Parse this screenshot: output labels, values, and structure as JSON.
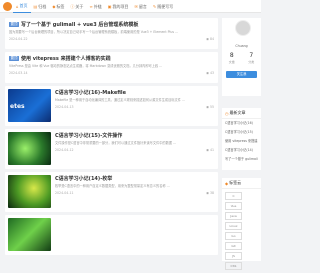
{
  "nav": {
    "items": [
      {
        "label": "首页",
        "icon": "home-icon",
        "active": true
      },
      {
        "label": "归档",
        "icon": "archive-icon",
        "active": false
      },
      {
        "label": "标签",
        "icon": "tag-icon",
        "active": false
      },
      {
        "label": "关于",
        "icon": "info-icon",
        "active": false
      },
      {
        "label": "外链",
        "icon": "link-icon",
        "active": false
      },
      {
        "label": "我的项目",
        "icon": "project-icon",
        "active": false
      },
      {
        "label": "留言",
        "icon": "message-icon",
        "active": false
      },
      {
        "label": "随便写写",
        "icon": "pen-icon",
        "active": false
      }
    ]
  },
  "posts": [
    {
      "tag": "置顶",
      "title": "写了一个基于 gulimall + vue3 后台管理系统模板",
      "excerpt": "因为需要写一个后台管理的项目，所以决定自己动手写一个后台管理系统模板，前端使用的是 Vue3 + Element Plus ...",
      "date": "2024-04-22",
      "views": "84"
    },
    {
      "tag": "置顶",
      "title": "使用 vitepress 来搭建个人博客的实践",
      "excerpt": "VitePress 是由 Vite 和 Vue 驱动的静态站点生成器，将 Markdown 变成优雅的文档，几分钟内即可上线 ...",
      "date": "2024-03-14",
      "views": "43"
    },
    {
      "thumb_text": "etes",
      "title": "C语言学习小记(16)-Makefile",
      "excerpt": "Makefile 是一种用于自动化编译的工具，通过定义规则来描述如何从源文件生成目标文件 ...",
      "date": "2024-04-13",
      "views": "55"
    },
    {
      "title": "C语言学习小记(15)-文件操作",
      "excerpt": "文件操作是C语言中非常重要的一部分，我们可以通过文件指针来读写文件中的数据 ...",
      "date": "2024-04-12",
      "views": "41"
    },
    {
      "title": "C语言学习小记(14)-枚举",
      "excerpt": "枚举是C语言中的一种用户自定义数据类型，用来为整型常量定义有意义的名称 ...",
      "date": "2024-04-11",
      "views": "38"
    }
  ],
  "profile": {
    "name": "Chuang",
    "stats": [
      {
        "num": "8",
        "label": "文章"
      },
      {
        "num": "7",
        "label": "分类"
      }
    ],
    "follow_label": "关注我"
  },
  "recent": {
    "title": "最新文章",
    "items": [
      "C语言学习小记(16)",
      "C语言学习小记(15)",
      "使用 vitepress 来搭建",
      "C语言学习小记(14)",
      "写了一个基于 gulimall"
    ]
  },
  "tagcloud": {
    "title": "标签云",
    "tags": [
      "C",
      "Vue",
      "Java",
      "Linux",
      "Go",
      "Git",
      "JS",
      "CSS"
    ]
  }
}
